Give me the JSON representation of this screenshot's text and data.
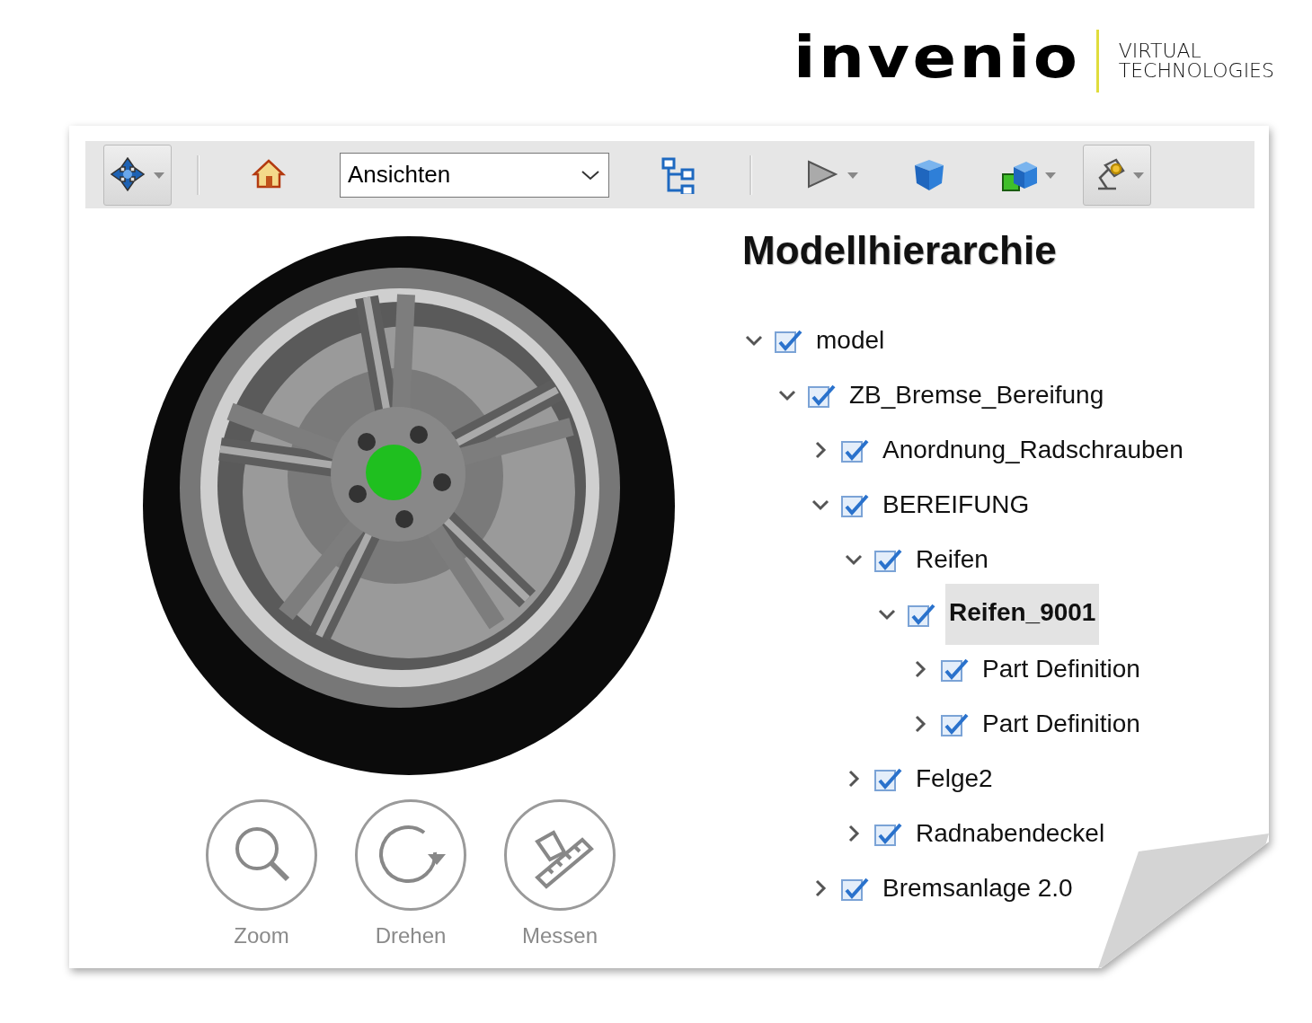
{
  "logo": {
    "wordmark": "invenio",
    "tagline_1": "VIRTUAL",
    "tagline_2": "TECHNOLOGIES"
  },
  "toolbar": [
    {
      "kind": "move",
      "pressed": true,
      "has_menu": true
    },
    {
      "kind": "separator"
    },
    {
      "kind": "home",
      "pressed": false,
      "has_menu": false
    },
    {
      "kind": "views",
      "value": "Ansichten"
    },
    {
      "kind": "tree",
      "pressed": false,
      "has_menu": false
    },
    {
      "kind": "separator"
    },
    {
      "kind": "play",
      "pressed": false,
      "has_menu": true
    },
    {
      "kind": "cube",
      "pressed": false,
      "has_menu": false
    },
    {
      "kind": "cubes",
      "pressed": false,
      "has_menu": true
    },
    {
      "kind": "lamp",
      "pressed": true,
      "has_menu": true
    }
  ],
  "tools": [
    {
      "kind": "zoom",
      "label": "Zoom"
    },
    {
      "kind": "rotate",
      "label": "Drehen"
    },
    {
      "kind": "measure",
      "label": "Messen"
    }
  ],
  "hierarchy": {
    "title": "Modellhierarchie",
    "tree": [
      {
        "label": "model",
        "checked": true,
        "expanded": true,
        "selected": false,
        "children": [
          {
            "label": "ZB_Bremse_Bereifung",
            "checked": true,
            "expanded": true,
            "selected": false,
            "children": [
              {
                "label": "Anordnung_Radschrauben",
                "checked": true,
                "expanded": false,
                "selected": false
              },
              {
                "label": "BEREIFUNG",
                "checked": true,
                "expanded": true,
                "selected": false,
                "children": [
                  {
                    "label": "Reifen",
                    "checked": true,
                    "expanded": true,
                    "selected": false,
                    "children": [
                      {
                        "label": "Reifen_9001",
                        "checked": true,
                        "expanded": true,
                        "selected": true,
                        "children": [
                          {
                            "label": "Part Definition",
                            "checked": true,
                            "expanded": false,
                            "selected": false
                          },
                          {
                            "label": "Part Definition",
                            "checked": true,
                            "expanded": false,
                            "selected": false
                          }
                        ]
                      }
                    ]
                  },
                  {
                    "label": "Felge2",
                    "checked": true,
                    "expanded": false,
                    "selected": false
                  },
                  {
                    "label": "Radnabendeckel",
                    "checked": true,
                    "expanded": false,
                    "selected": false
                  }
                ]
              },
              {
                "label": "Bremsanlage 2.0",
                "checked": true,
                "expanded": false,
                "selected": false
              }
            ]
          }
        ]
      }
    ]
  }
}
